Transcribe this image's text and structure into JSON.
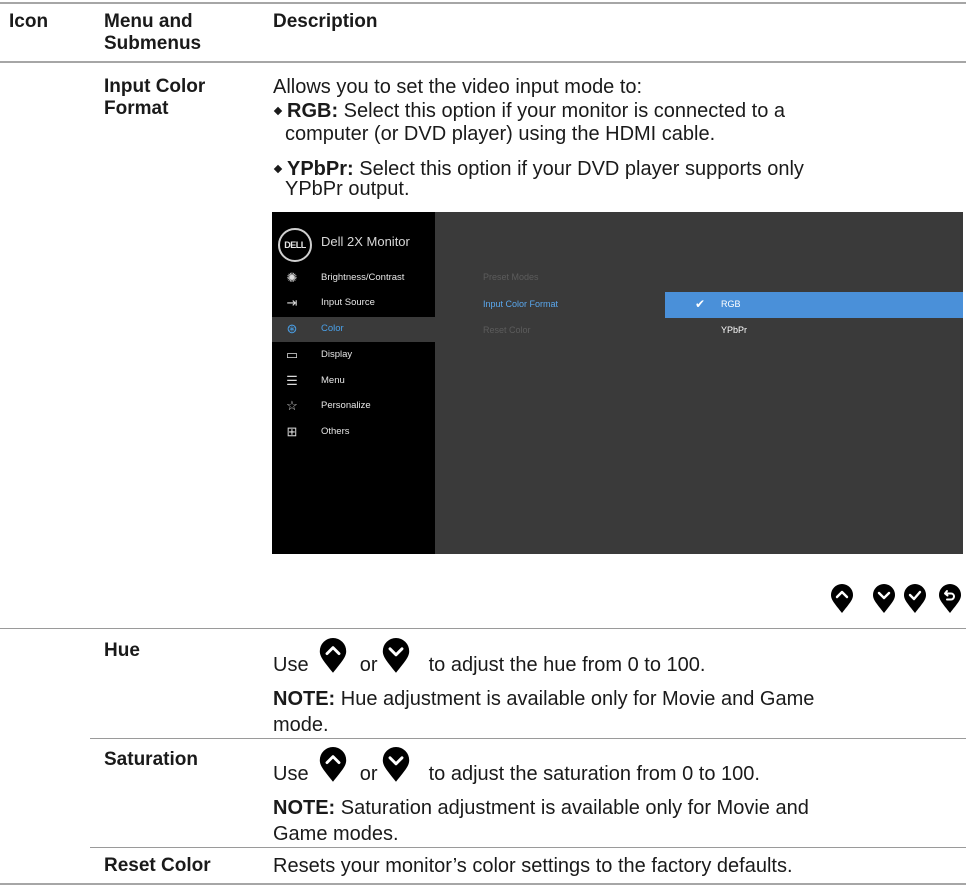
{
  "header": {
    "col_icon": "Icon",
    "col_menu": "Menu and Submenus",
    "col_description": "Description"
  },
  "input_color_format": {
    "name_line1": "Input Color",
    "name_line2": "Format",
    "intro": "Allows you to set the video input mode to:",
    "bullets": [
      {
        "term": "RGB:",
        "line1": " Select this option if your monitor is connected to a",
        "line2": "computer (or DVD player) using the HDMI cable."
      },
      {
        "term": "YPbPr:",
        "line1": " Select this option if your DVD player supports only",
        "line2": "YPbPr output."
      }
    ]
  },
  "osd": {
    "logo": "DELL",
    "title": "Dell 2X Monitor",
    "menu": [
      {
        "label": "Brightness/Contrast",
        "icon": "brightness-icon"
      },
      {
        "label": "Input Source",
        "icon": "input-source-icon"
      },
      {
        "label": "Color",
        "icon": "color-palette-icon",
        "active": true
      },
      {
        "label": "Display",
        "icon": "display-icon"
      },
      {
        "label": "Menu",
        "icon": "menu-icon"
      },
      {
        "label": "Personalize",
        "icon": "star-icon"
      },
      {
        "label": "Others",
        "icon": "others-icon"
      }
    ],
    "submenu": [
      "Preset Modes",
      "Input Color Format",
      "Reset Color"
    ],
    "options": [
      "RGB",
      "YPbPr"
    ],
    "selected_option": "RGB",
    "colors": {
      "selection": "#4a90d9",
      "active_text": "#4aa0e8",
      "panel": "#3a3a3a",
      "sidebar": "#000000"
    }
  },
  "nav_buttons": [
    "up-icon",
    "down-icon",
    "check-icon",
    "back-icon"
  ],
  "hue": {
    "name": "Hue",
    "use": "Use",
    "or": "or",
    "rest": "to adjust the hue from 0 to 100.",
    "note_label": "NOTE:",
    "note_line1": " Hue adjustment is available only for Movie and Game",
    "note_line2": "mode."
  },
  "saturation": {
    "name": "Saturation",
    "use": "Use",
    "or": "or",
    "rest": "to adjust the saturation from 0 to 100.",
    "note_label": "NOTE:",
    "note_line1": " Saturation adjustment is available only for Movie and",
    "note_line2": "Game modes."
  },
  "reset_color": {
    "name": "Reset Color",
    "description": "Resets your monitor’s color settings to the factory defaults."
  }
}
